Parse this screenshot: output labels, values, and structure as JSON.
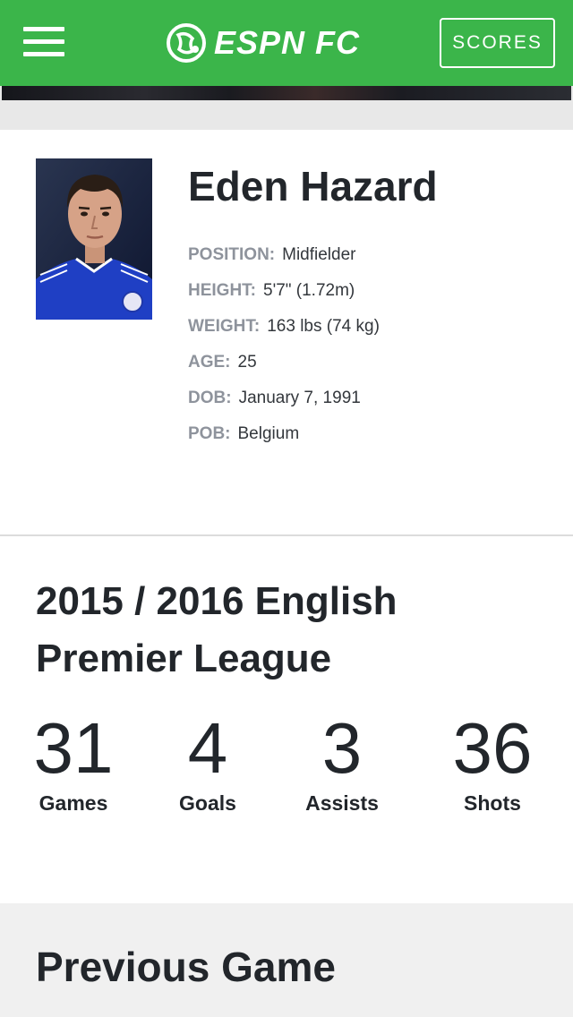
{
  "header": {
    "brand": "ESPN FC",
    "scores_label": "SCORES",
    "bg_color": "#3bb54a"
  },
  "player": {
    "name": "Eden Hazard",
    "info": [
      {
        "label": "POSITION:",
        "value": "Midfielder"
      },
      {
        "label": "HEIGHT:",
        "value": "5'7\" (1.72m)"
      },
      {
        "label": "WEIGHT:",
        "value": "163 lbs (74 kg)"
      },
      {
        "label": "AGE:",
        "value": "25"
      },
      {
        "label": "DOB:",
        "value": "January 7, 1991"
      },
      {
        "label": "POB:",
        "value": "Belgium"
      }
    ]
  },
  "season": {
    "title": "2015 / 2016 English Premier League",
    "stats": [
      {
        "value": "31",
        "label": "Games"
      },
      {
        "value": "4",
        "label": "Goals"
      },
      {
        "value": "3",
        "label": "Assists"
      },
      {
        "value": "36",
        "label": "Shots"
      }
    ]
  },
  "previous_game": {
    "title": "Previous Game"
  }
}
